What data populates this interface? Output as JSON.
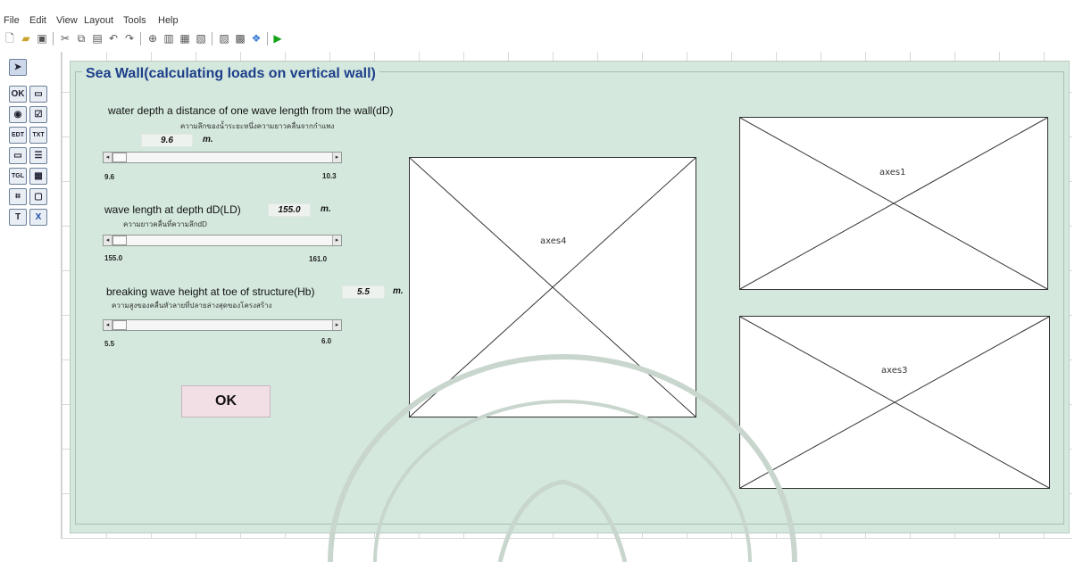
{
  "menu": [
    "File",
    "Edit",
    "View",
    "Layout",
    "Tools",
    "Help"
  ],
  "toolbar_icons": [
    "new-file-icon",
    "open-folder-icon",
    "save-icon",
    "cut-icon",
    "copy-icon",
    "paste-icon",
    "undo-icon",
    "redo-icon",
    "align-icon",
    "menu-editor-icon",
    "tab-order-icon",
    "toolbar-editor-icon",
    "m-file-editor-icon",
    "property-inspector-icon",
    "object-browser-icon",
    "run-icon"
  ],
  "palette": [
    {
      "name": "select-tool-icon",
      "glyph": "➤"
    },
    {
      "name": "push-button-icon",
      "glyph": "OK"
    },
    {
      "name": "slider-icon",
      "glyph": "▭"
    },
    {
      "name": "radio-button-icon",
      "glyph": "◉"
    },
    {
      "name": "check-box-icon",
      "glyph": "☑"
    },
    {
      "name": "edit-text-icon",
      "glyph": "EDT"
    },
    {
      "name": "static-text-icon",
      "glyph": "TXT"
    },
    {
      "name": "popup-menu-icon",
      "glyph": "▭"
    },
    {
      "name": "listbox-icon",
      "glyph": "☰"
    },
    {
      "name": "toggle-button-icon",
      "glyph": "TGL"
    },
    {
      "name": "table-icon",
      "glyph": "▦"
    },
    {
      "name": "axes-icon",
      "glyph": "⌗"
    },
    {
      "name": "panel-icon",
      "glyph": "▢"
    },
    {
      "name": "button-group-icon",
      "glyph": "T"
    },
    {
      "name": "activex-icon",
      "glyph": "X"
    }
  ],
  "panel": {
    "title": "Sea Wall(calculating loads on vertical wall)"
  },
  "params": [
    {
      "label": "water depth a distance of one wave length from the wall(dD)",
      "sublabel": "ความลึกของน้ำระยะหนึ่งความยาวคลื่นจากกำแพง",
      "value": "9.6",
      "unit": "m.",
      "min": "9.6",
      "max": "10.3",
      "position": 0.0
    },
    {
      "label": "wave length at depth dD(LD)",
      "sublabel": "ความยาวคลื่นที่ความลึกdD",
      "value": "155.0",
      "unit": "m.",
      "min": "155.0",
      "max": "161.0",
      "position": 0.0
    },
    {
      "label": "breaking wave height at toe of structure(Hb)",
      "sublabel": "ความสูงของคลื่นหัวลายที่ปลายล่างสุดของโครงสร้าง",
      "value": "5.5",
      "unit": "m.",
      "min": "5.5",
      "max": "6.0",
      "position": 0.0
    }
  ],
  "ok_label": "OK",
  "axes": [
    {
      "label": "axes4"
    },
    {
      "label": "axes1"
    },
    {
      "label": "axes3"
    }
  ]
}
